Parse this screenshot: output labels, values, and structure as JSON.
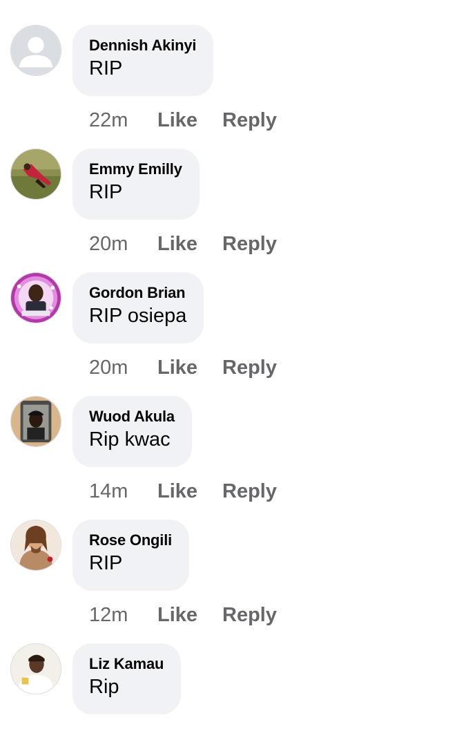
{
  "comments": [
    {
      "author": "Dennish Akinyi",
      "text": "RIP",
      "time": "22m",
      "like": "Like",
      "reply": "Reply",
      "avatar": "default-avatar-icon"
    },
    {
      "author": "Emmy Emilly",
      "text": "RIP",
      "time": "20m",
      "like": "Like",
      "reply": "Reply",
      "avatar": "profile-photo"
    },
    {
      "author": "Gordon Brian",
      "text": "RIP osiepa",
      "time": "20m",
      "like": "Like",
      "reply": "Reply",
      "avatar": "profile-photo"
    },
    {
      "author": "Wuod Akula",
      "text": "Rip kwac",
      "time": "14m",
      "like": "Like",
      "reply": "Reply",
      "avatar": "profile-photo"
    },
    {
      "author": "Rose Ongili",
      "text": "RIP",
      "time": "12m",
      "like": "Like",
      "reply": "Reply",
      "avatar": "profile-photo"
    },
    {
      "author": "Liz Kamau",
      "text": "Rip",
      "time": "",
      "like": "",
      "reply": "",
      "avatar": "profile-photo"
    }
  ],
  "colors": {
    "bubble": "#f0f2f5",
    "name_text": "#050505",
    "meta_text": "#65676b"
  }
}
